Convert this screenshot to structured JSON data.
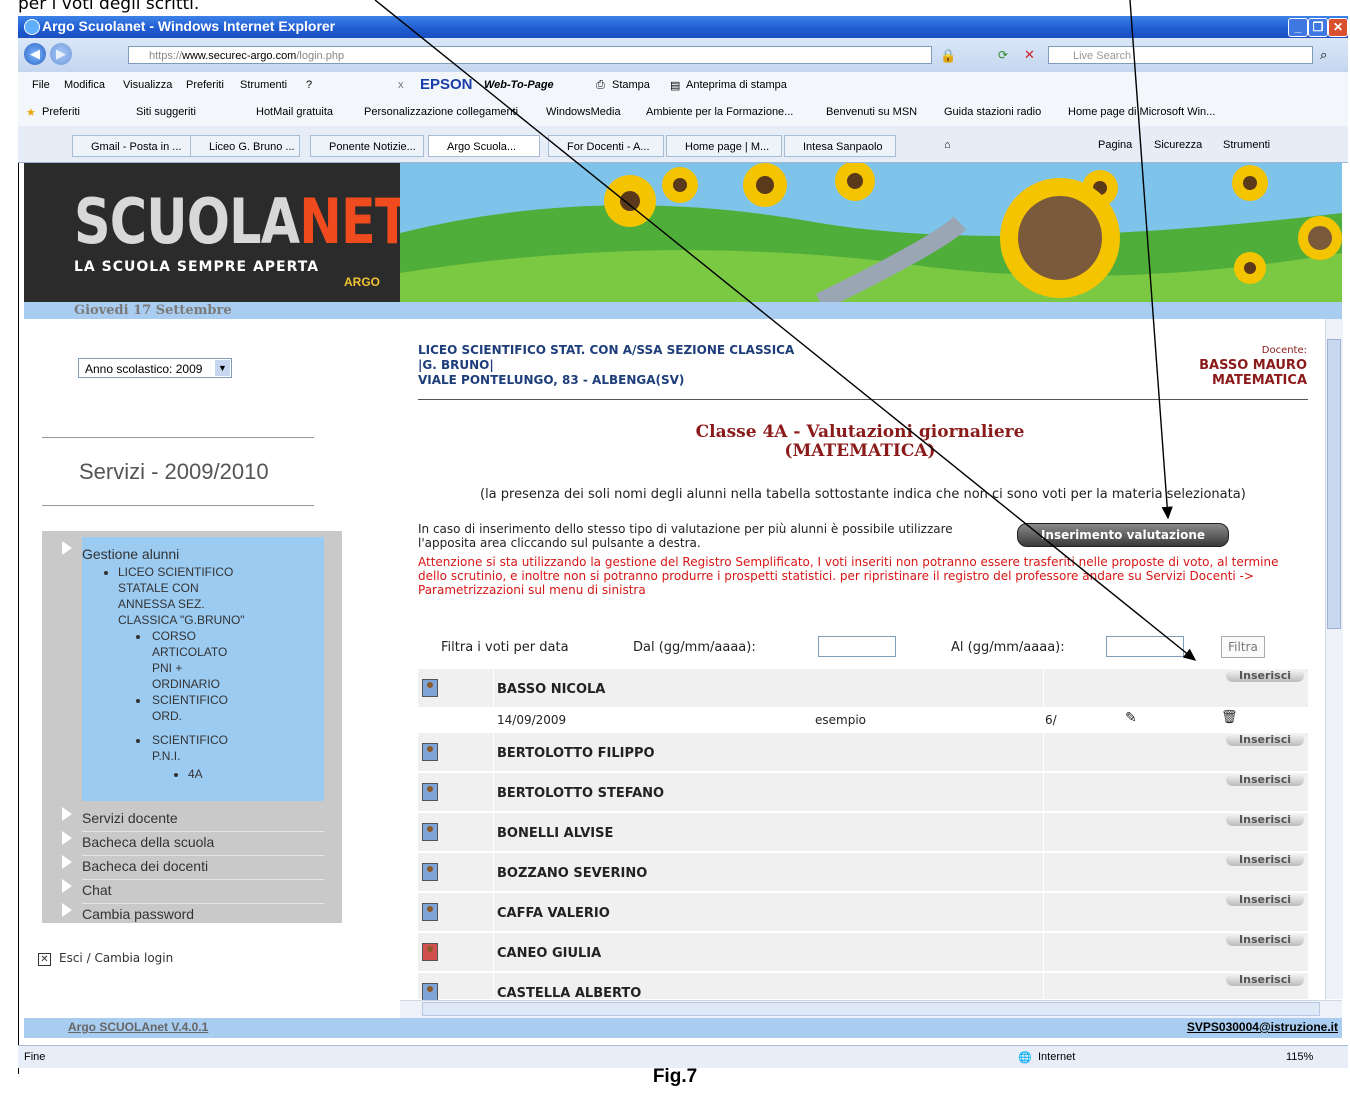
{
  "document": {
    "caption_top": "per i voti degli scritti.",
    "figure_label": "Fig.7"
  },
  "window": {
    "title": "Argo Scuolanet - Windows Internet Explorer"
  },
  "addressbar": {
    "scheme": "https://",
    "host": "www.securec-argo.com",
    "path": "/login.php",
    "search_placeholder": "Live Search"
  },
  "menubar": {
    "items": [
      "File",
      "Modifica",
      "Visualizza",
      "Preferiti",
      "Strumenti",
      "?"
    ],
    "epson": "EPSON",
    "webtopage": "Web-To-Page",
    "stampa": "Stampa",
    "anteprima": "Anteprima di stampa"
  },
  "favorites": {
    "label": "Preferiti",
    "items": [
      "Siti suggeriti",
      "HotMail gratuita",
      "Personalizzazione collegamenti",
      "WindowsMedia",
      "Ambiente per la Formazione...",
      "Benvenuti su MSN",
      "Guida stazioni radio",
      "Home page di Microsoft Win..."
    ]
  },
  "tabs": {
    "items": [
      "Gmail - Posta in ...",
      "Liceo G. Bruno ...",
      "Ponente Notizie...",
      "Argo Scuola...",
      "For Docenti - A...",
      "Home page | M...",
      "Intesa Sanpaolo"
    ],
    "active": 3,
    "right": [
      "Pagina",
      "Sicurezza",
      "Strumenti"
    ]
  },
  "banner": {
    "logo_a": "SCUOLA",
    "logo_b": "NET",
    "slogan": "LA SCUOLA SEMPRE APERTA",
    "argo": "ARGO"
  },
  "date": "Giovedi 17 Settembre",
  "sidebar": {
    "year_select": "Anno scolastico: 2009",
    "heading": "Servizi - 2009/2010",
    "gestione": "Gestione alunni",
    "tree": {
      "school": [
        "LICEO SCIENTIFICO",
        "STATALE CON",
        "ANNESSA SEZ.",
        "CLASSICA \"G.BRUNO\""
      ],
      "corso": [
        "CORSO",
        "ARTICOLATO",
        "PNI +",
        "ORDINARIO"
      ],
      "sci_ord": [
        "SCIENTIFICO",
        "ORD."
      ],
      "sci_pni": [
        "SCIENTIFICO",
        "P.N.I."
      ],
      "classe": "4A"
    },
    "items": [
      "Servizi docente",
      "Bacheca della scuola",
      "Bacheca dei docenti",
      "Chat",
      "Cambia password"
    ],
    "logout": "Esci / Cambia login"
  },
  "school": {
    "line1": "LICEO SCIENTIFICO STAT. CON A/SSA SEZIONE CLASSICA",
    "line2": "|G. BRUNO|",
    "line3": "VIALE PONTELUNGO, 83 - ALBENGA(SV)"
  },
  "teacher": {
    "label": "Docente:",
    "name": "BASSO MAURO",
    "subject": "MATEMATICA"
  },
  "page": {
    "title": "Classe 4A - Valutazioni giornaliere",
    "subtitle": "(MATEMATICA)",
    "note": "(la presenza dei soli nomi degli alunni nella tabella sottostante indica che non ci sono voti per la materia selezionata)",
    "info": "In caso di inserimento dello stesso tipo di valutazione per più alunni è possibile utilizzare l'apposita area cliccando sul pulsante a destra.",
    "collective_button": "Inserimento valutazione collettiva",
    "warning": "Attenzione si sta utilizzando la gestione del Registro Semplificato, I voti inseriti non potranno essere trasferiti nelle proposte di voto, al termine dello scrutinio, e inoltre non si potranno produrre i prospetti statistici. per ripristinare il registro del professore andare su Servizi Docenti -> Parametrizzazioni sul menu di sinistra"
  },
  "filter": {
    "label": "Filtra i voti per data",
    "from": "Dal (gg/mm/aaaa):",
    "to": "Al (gg/mm/aaaa):",
    "button": "Filtra"
  },
  "students": [
    {
      "name": "BASSO NICOLA",
      "insert": "Inserisci"
    },
    {
      "name": "BERTOLOTTO FILIPPO",
      "insert": "Inserisci"
    },
    {
      "name": "BERTOLOTTO STEFANO",
      "insert": "Inserisci"
    },
    {
      "name": "BONELLI ALVISE",
      "insert": "Inserisci"
    },
    {
      "name": "BOZZANO SEVERINO",
      "insert": "Inserisci"
    },
    {
      "name": "CAFFA VALERIO",
      "insert": "Inserisci"
    },
    {
      "name": "CANEO GIULIA",
      "insert": "Inserisci"
    },
    {
      "name": "CASTELLA ALBERTO",
      "insert": "Inserisci"
    }
  ],
  "grade_row": {
    "date": "14/09/2009",
    "type": "esempio",
    "value": "6/"
  },
  "footer": {
    "version": "Argo SCUOLAnet V.4.0.1",
    "email": "SVPS030004@istruzione.it"
  },
  "status": {
    "left": "Fine",
    "zone": "Internet",
    "zoom": "115%"
  }
}
